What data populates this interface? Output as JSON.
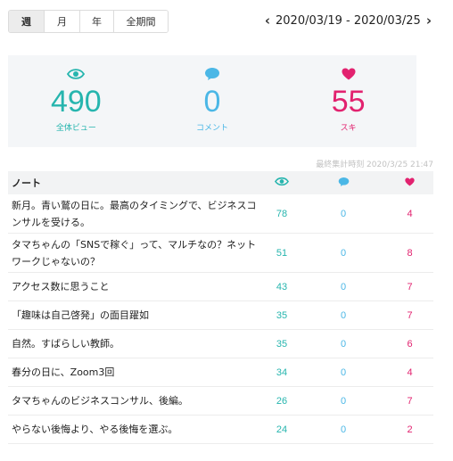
{
  "tabs": [
    {
      "label": "週",
      "active": true
    },
    {
      "label": "月",
      "active": false
    },
    {
      "label": "年",
      "active": false
    },
    {
      "label": "全期間",
      "active": false
    }
  ],
  "date_nav": {
    "prev_icon": "chevron-left-icon",
    "range": "2020/03/19 - 2020/03/25",
    "next_icon": "chevron-right-icon"
  },
  "summary": {
    "views": {
      "value": "490",
      "label": "全体ビュー",
      "icon": "eye-icon",
      "color": "#26b5ae"
    },
    "comments": {
      "value": "0",
      "label": "コメント",
      "icon": "speech-bubble-icon",
      "color": "#4bb7e6"
    },
    "likes": {
      "value": "55",
      "label": "スキ",
      "icon": "heart-icon",
      "color": "#e2226f"
    }
  },
  "updated_at": "最終集計時刻 2020/3/25 21:47",
  "table": {
    "header": {
      "title": "ノート"
    },
    "rows": [
      {
        "title": "新月。青い鷲の日に。最高のタイミングで、ビジネスコンサルを受ける。",
        "views": "78",
        "comments": "0",
        "likes": "4"
      },
      {
        "title": "タマちゃんの「SNSで稼ぐ」って、マルチなの？ネットワークじゃないの？",
        "views": "51",
        "comments": "0",
        "likes": "8"
      },
      {
        "title": "アクセス数に思うこと",
        "views": "43",
        "comments": "0",
        "likes": "7"
      },
      {
        "title": "「趣味は自己啓発」の面目躍如",
        "views": "35",
        "comments": "0",
        "likes": "7"
      },
      {
        "title": "自然。すばらしい教師。",
        "views": "35",
        "comments": "0",
        "likes": "6"
      },
      {
        "title": "春分の日に、Zoom3回",
        "views": "34",
        "comments": "0",
        "likes": "4"
      },
      {
        "title": "タマちゃんのビジネスコンサル、後編。",
        "views": "26",
        "comments": "0",
        "likes": "7"
      },
      {
        "title": "やらない後悔より、やる後悔を選ぶ。",
        "views": "24",
        "comments": "0",
        "likes": "2"
      }
    ]
  }
}
